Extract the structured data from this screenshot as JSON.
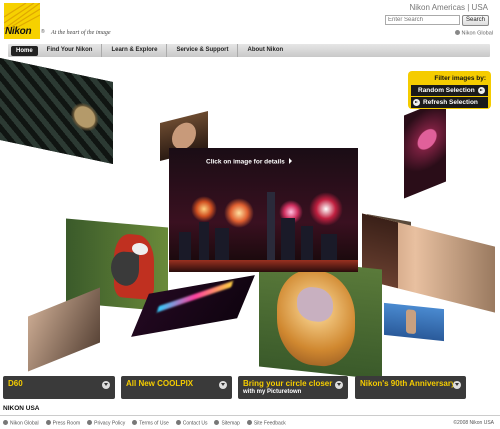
{
  "header": {
    "logo_text": "Nikon",
    "registered": "®",
    "tagline": "At the heart of the image",
    "region": "Nikon Americas  |  USA",
    "search_placeholder": "Enter Search",
    "search_button": "Search",
    "global_link": "Nikon Global"
  },
  "nav": {
    "items": [
      {
        "label": "Home",
        "active": true
      },
      {
        "label": "Find Your Nikon"
      },
      {
        "label": "Learn & Explore"
      },
      {
        "label": "Service & Support"
      },
      {
        "label": "About Nikon"
      }
    ]
  },
  "filter": {
    "title": "Filter images by:",
    "options": [
      "Random Selection",
      "Refresh Selection"
    ]
  },
  "hint": "Click on image for details",
  "promos": [
    {
      "title": "D60",
      "sub": ""
    },
    {
      "title": "All New COOLPIX",
      "sub": ""
    },
    {
      "title": "Bring your circle closer",
      "sub": "with my Picturetown"
    },
    {
      "title": "Nikon's 90th Anniversary",
      "sub": ""
    }
  ],
  "footer": {
    "title": "NIKON USA",
    "links": [
      "Nikon Global",
      "Press Room",
      "Privacy Policy",
      "Terms of Use",
      "Contact Us",
      "Sitemap",
      "Site Feedback"
    ],
    "copyright": "©2008 Nikon USA"
  },
  "colors": {
    "brand_yellow": "#f5cc00",
    "bar_dark": "#3a3a3a"
  }
}
